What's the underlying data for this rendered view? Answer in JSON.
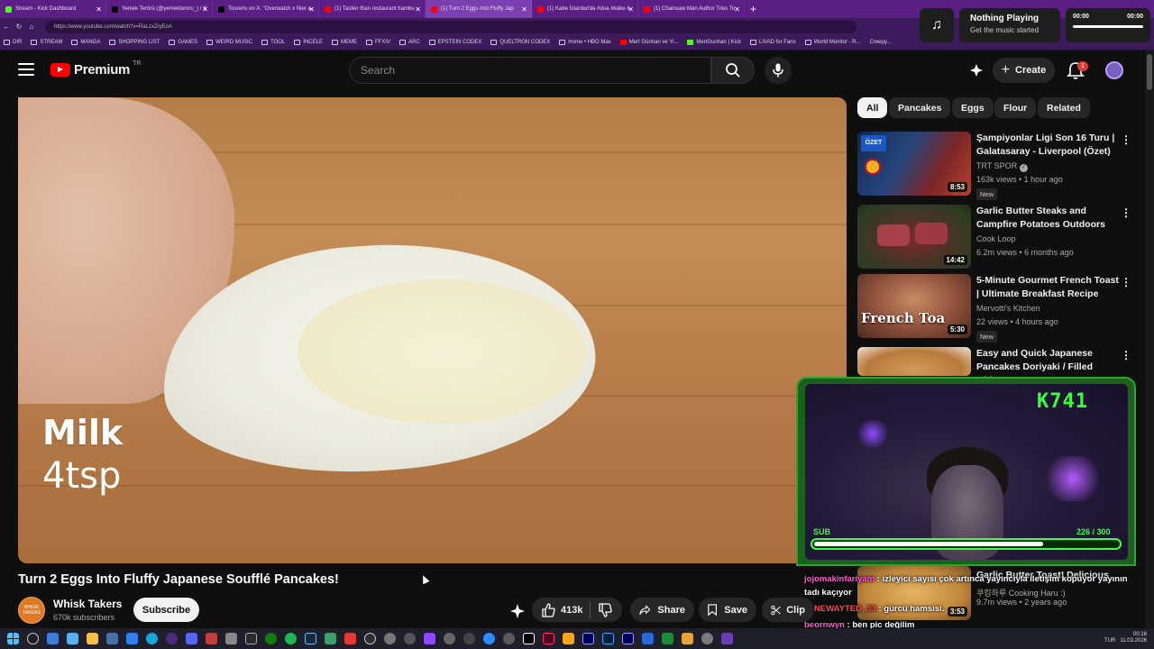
{
  "browser": {
    "tabs": [
      {
        "label": "Stream - Kick Dashboard",
        "color": "#53fc18"
      },
      {
        "label": "Yemek Terörü (@yemekteroru_) / X",
        "color": "#000000"
      },
      {
        "label": "Tourens on X: \"Overwatch x Nier a",
        "color": "#000000"
      },
      {
        "label": "(1) Tastier than restaurant hambu",
        "color": "#ff0000"
      },
      {
        "label": "(1) Turn 2 Eggs Into Fluffy Jap",
        "color": "#ff0000"
      },
      {
        "label": "(1) Kabe İstanbul'da #dua #kabe #",
        "color": "#ff0000"
      },
      {
        "label": "(1) Chainsaw Man Author Tries To",
        "color": "#ff0000"
      }
    ],
    "url": "https://www.youtube.com/watch?v=RaLzxZryEoA",
    "bookmarks": [
      "DIR",
      "STREAM",
      "MANGA",
      "SHOPPING LIST",
      "GAMES",
      "WEIRD MUSIC",
      "TOOL",
      "İNCELE",
      "MEME",
      "FFXIV",
      "ARC",
      "EPSTEIN CODEX",
      "QUELTRON CODEX",
      "Home • HBO Max",
      "Mert Günhan ve Yi...",
      "MertGunhan | Kick",
      "LIVAD for Fans",
      "World Monitor - R...",
      "Creepy..."
    ]
  },
  "music": {
    "title": "Nothing Playing",
    "subtitle": "Get the music started",
    "time_start": "00:00",
    "time_end": "00:00"
  },
  "header": {
    "logo": "Premium",
    "region": "TR",
    "search_placeholder": "Search",
    "create_label": "Create",
    "notification_count": "1"
  },
  "video": {
    "overlay_word": "Milk",
    "overlay_qty": "4tsp",
    "title": "Turn 2 Eggs Into Fluffy Japanese Soufflé Pancakes!",
    "channel": "Whisk Takers",
    "channel_avatar_text": "WHISK TAKERS",
    "subscribers": "670k subscribers",
    "subscribe_label": "Subscribe",
    "likes": "413k",
    "share_label": "Share",
    "save_label": "Save",
    "clip_label": "Clip"
  },
  "chips": [
    "All",
    "Pancakes",
    "Eggs",
    "Flour",
    "Related"
  ],
  "sidebar": [
    {
      "title": "Şampiyonlar Ligi Son 16 Turu | Galatasaray - Liverpool (Özet)",
      "channel": "TRT SPOR",
      "views": "163k views • 1 hour ago",
      "badge": "New",
      "duration": "8:53",
      "thumb_label": "ÖZET"
    },
    {
      "title": "Garlic Butter Steaks and Campfire Potatoes Outdoors",
      "channel": "Cook Loop",
      "views": "6.2m views • 6 months ago",
      "badge": "",
      "duration": "14:42",
      "thumb_label": ""
    },
    {
      "title": "5-Minute Gourmet French Toast | Ultimate Breakfast Recipe",
      "channel": "Mervotti's Kitchen",
      "views": "22 views • 4 hours ago",
      "badge": "New",
      "duration": "5:30",
      "thumb_label": "French Toa"
    },
    {
      "title": "Easy and Quick Japanese Pancakes Doriyaki / Filled with...",
      "channel": "",
      "views": "",
      "badge": "",
      "duration": "",
      "thumb_label": ""
    },
    {
      "title": "Garlic Butter Toast! Delicious",
      "channel": "쿠킹하루 Cooking Haru :)",
      "views": "9.7m views • 2 years ago",
      "badge": "",
      "duration": "3:53",
      "thumb_label": ""
    }
  ],
  "stream": {
    "score": "K741",
    "sub_label": "SUB",
    "sub_count": "226 / 300",
    "sub_progress": 0.753
  },
  "chat": [
    {
      "user": "jojomakinfariyam",
      "msg": " : izleyici sayısı çok artınca yayıncıyla iletişim kopuyor yayının"
    },
    {
      "user": "",
      "msg": "tadı kaçıyor"
    },
    {
      "user": "NEWAYTED_33",
      "msg": " : gürcü hamsisi."
    },
    {
      "user": "beornwyn",
      "msg": " : ben pic değilim"
    }
  ],
  "tray": {
    "lang": "TUR",
    "time": "00:18",
    "date": "11.03.2026"
  }
}
